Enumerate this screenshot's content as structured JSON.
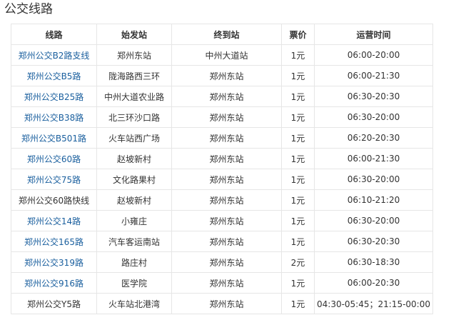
{
  "section": {
    "title": "公交线路"
  },
  "table": {
    "headers": [
      "线路",
      "始发站",
      "终到站",
      "票价",
      "运营时间"
    ],
    "rows": [
      {
        "route": "郑州公交B2路支线",
        "route_link": true,
        "start": "郑州东站",
        "end": "中州大道站",
        "fare": "1元",
        "hours": "06:00-20:00"
      },
      {
        "route": "郑州公交B5路",
        "route_link": true,
        "start": "陇海路西三环",
        "end": "郑州东站",
        "fare": "1元",
        "hours": "06:00-21:30"
      },
      {
        "route": "郑州公交B25路",
        "route_link": true,
        "start": "中州大道农业路",
        "end": "郑州东站",
        "fare": "1元",
        "hours": "06:30-20:30"
      },
      {
        "route": "郑州公交B38路",
        "route_link": true,
        "start": "北三环沙口路",
        "end": "郑州东站",
        "fare": "1元",
        "hours": "06:30-20:00"
      },
      {
        "route": "郑州公交B501路",
        "route_link": true,
        "start": "火车站西广场",
        "end": "郑州东站",
        "fare": "1元",
        "hours": "06:20-20:30"
      },
      {
        "route": "郑州公交60路",
        "route_link": true,
        "start": "赵坡新村",
        "end": "郑州东站",
        "fare": "1元",
        "hours": "06:00-21:30"
      },
      {
        "route": "郑州公交75路",
        "route_link": true,
        "start": "文化路果村",
        "end": "郑州东站",
        "fare": "1元",
        "hours": "06:30-20:00"
      },
      {
        "route": "郑州公交60路快线",
        "route_link": false,
        "start": "赵坡新村",
        "end": "郑州东站",
        "fare": "1元",
        "hours": "06:10-21:20"
      },
      {
        "route": "郑州公交14路",
        "route_link": true,
        "start": "小雍庄",
        "end": "郑州东站",
        "fare": "1元",
        "hours": "06:30-20:00"
      },
      {
        "route": "郑州公交165路",
        "route_link": true,
        "start": "汽车客运南站",
        "end": "郑州东站",
        "fare": "1元",
        "hours": "06:30-20:30"
      },
      {
        "route": "郑州公交319路",
        "route_link": true,
        "start": "路庄村",
        "end": "郑州东站",
        "fare": "2元",
        "hours": "06:30-18:30"
      },
      {
        "route": "郑州公交916路",
        "route_link": true,
        "start": "医学院",
        "end": "郑州东站",
        "fare": "1元",
        "hours": "06:00-20:30"
      },
      {
        "route": "郑州公交Y5路",
        "route_link": false,
        "start": "火车站北港湾",
        "end": "郑州东站",
        "fare": "1元",
        "hours": "04:30-05:45；21:15-00:00"
      }
    ]
  },
  "colors": {
    "link": "#1a5f9e",
    "text": "#333333",
    "border": "#e6e6e6"
  }
}
